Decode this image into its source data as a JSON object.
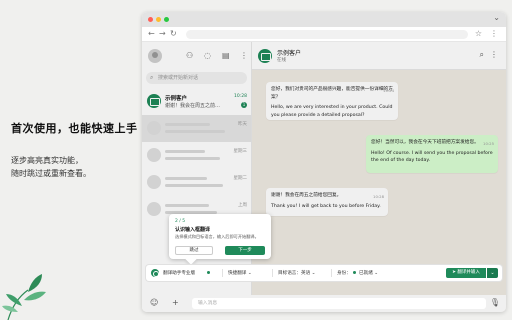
{
  "promo": {
    "title": "首次使用，也能快速上手",
    "desc_line1": "逐步高亮真实功能，",
    "desc_line2": "随时跳过或重新查看。"
  },
  "colors": {
    "brand": "#1f8a5a",
    "out_bubble": "#d9fdd3",
    "chat_bg": "#efeae2"
  },
  "sidebar": {
    "search_placeholder": "搜索或开始新对话",
    "active_chat": {
      "name": "示例客户",
      "message": "谢谢！我会在周五之前…",
      "time": "10:28",
      "badge": "1"
    },
    "placeholder_times": [
      "昨天",
      "星期三",
      "星期二",
      "上周"
    ]
  },
  "chat": {
    "name": "示例客户",
    "status": "在线",
    "messages": [
      {
        "dir": "in",
        "text": "您好，我们对贵司的产品很感兴趣，能否提供一份详细的方案？",
        "translation": "Hello, we are very interested in your product. Could you please provide a detailed proposal?",
        "time": "10:24"
      },
      {
        "dir": "out",
        "text": "您好！当然可以，我会在今天下班前把方案发给您。",
        "translation": "Hello! Of course. I will send you the proposal before the end of the day today.",
        "time": "10:25"
      },
      {
        "dir": "in",
        "text": "谢谢！我会在周五之前给您回复。",
        "translation": "Thank you! I will get back to you before Friday.",
        "time": "10:28"
      }
    ]
  },
  "tour": {
    "step": "2 / 5",
    "title": "认识输入框翻译",
    "desc": "选择模式和目标语言，输入后即可开始翻译。",
    "skip_label": "跳过",
    "next_label": "下一步"
  },
  "toolbar": {
    "assistant_label": "翻译助手专业版",
    "mode_label": "快捷翻译",
    "target_label": "目标语言：",
    "target_value": "英语",
    "identity_label": "身份：",
    "identity_value": "已就绪",
    "send_label": "翻译并输入"
  },
  "input": {
    "placeholder": "输入消息"
  },
  "icons": {
    "sidebar": [
      "community-icon",
      "status-icon",
      "channels-icon",
      "menu-icon"
    ],
    "chat_head": [
      "search-icon",
      "menu-icon"
    ],
    "input": [
      "emoji-icon",
      "attach-icon",
      "mic-icon"
    ]
  }
}
